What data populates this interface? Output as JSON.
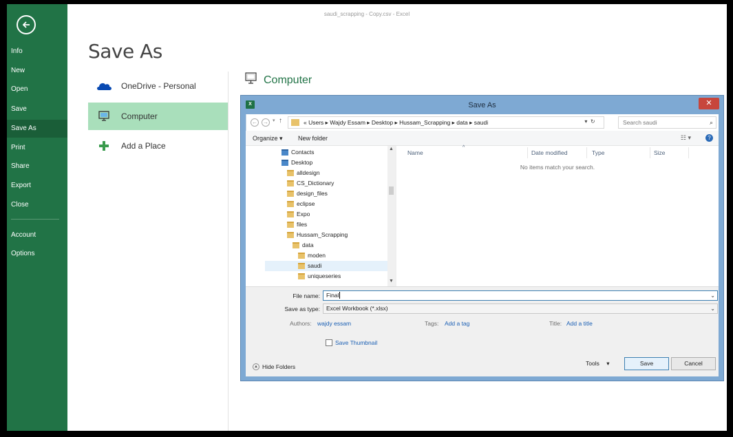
{
  "window": {
    "title": "saudi_scrapping - Copy.csv - Excel"
  },
  "sidebar": {
    "items": [
      {
        "label": "Info"
      },
      {
        "label": "New"
      },
      {
        "label": "Open"
      },
      {
        "label": "Save"
      },
      {
        "label": "Save As"
      },
      {
        "label": "Print"
      },
      {
        "label": "Share"
      },
      {
        "label": "Export"
      },
      {
        "label": "Close"
      },
      {
        "label": "Account"
      },
      {
        "label": "Options"
      }
    ],
    "active": "Save As"
  },
  "page": {
    "title": "Save As",
    "places": [
      {
        "label": "OneDrive - Personal",
        "icon": "cloud-icon"
      },
      {
        "label": "Computer",
        "icon": "computer-icon"
      },
      {
        "label": "Add a Place",
        "icon": "plus-icon"
      }
    ],
    "section_header": "Computer"
  },
  "dialog": {
    "title": "Save As",
    "path": "« Users  ▸  Wajdy Essam  ▸  Desktop  ▸  Hussam_Scrapping  ▸  data  ▸  saudi",
    "search_placeholder": "Search saudi",
    "toolbar": {
      "organize": "Organize ▾",
      "new_folder": "New folder"
    },
    "tree": [
      {
        "label": "Contacts",
        "indent": 0,
        "type": "special"
      },
      {
        "label": "Desktop",
        "indent": 0,
        "type": "special"
      },
      {
        "label": "alldesign",
        "indent": 1,
        "type": "folder"
      },
      {
        "label": "CS_Dictionary",
        "indent": 1,
        "type": "folder"
      },
      {
        "label": "design_files",
        "indent": 1,
        "type": "folder"
      },
      {
        "label": "eclipse",
        "indent": 1,
        "type": "folder"
      },
      {
        "label": "Expo",
        "indent": 1,
        "type": "folder"
      },
      {
        "label": "files",
        "indent": 1,
        "type": "folder"
      },
      {
        "label": "Hussam_Scrapping",
        "indent": 1,
        "type": "folder"
      },
      {
        "label": "data",
        "indent": 2,
        "type": "folder"
      },
      {
        "label": "moden",
        "indent": 3,
        "type": "folder"
      },
      {
        "label": "saudi",
        "indent": 3,
        "type": "folder",
        "selected": true
      },
      {
        "label": "uniqueseries",
        "indent": 3,
        "type": "folder"
      }
    ],
    "columns": [
      "Name",
      "Date modified",
      "Type",
      "Size"
    ],
    "empty_message": "No items match your search.",
    "file_name_label": "File name:",
    "file_name_value": "Final",
    "save_type_label": "Save as type:",
    "save_type_value": "Excel Workbook (*.xlsx)",
    "authors_label": "Authors:",
    "authors_value": "wajdy essam",
    "tags_label": "Tags:",
    "tags_value": "Add a tag",
    "title_label": "Title:",
    "title_value": "Add a title",
    "save_thumbnail": "Save Thumbnail",
    "hide_folders": "Hide Folders",
    "tools": "Tools",
    "save_button": "Save",
    "cancel_button": "Cancel"
  }
}
